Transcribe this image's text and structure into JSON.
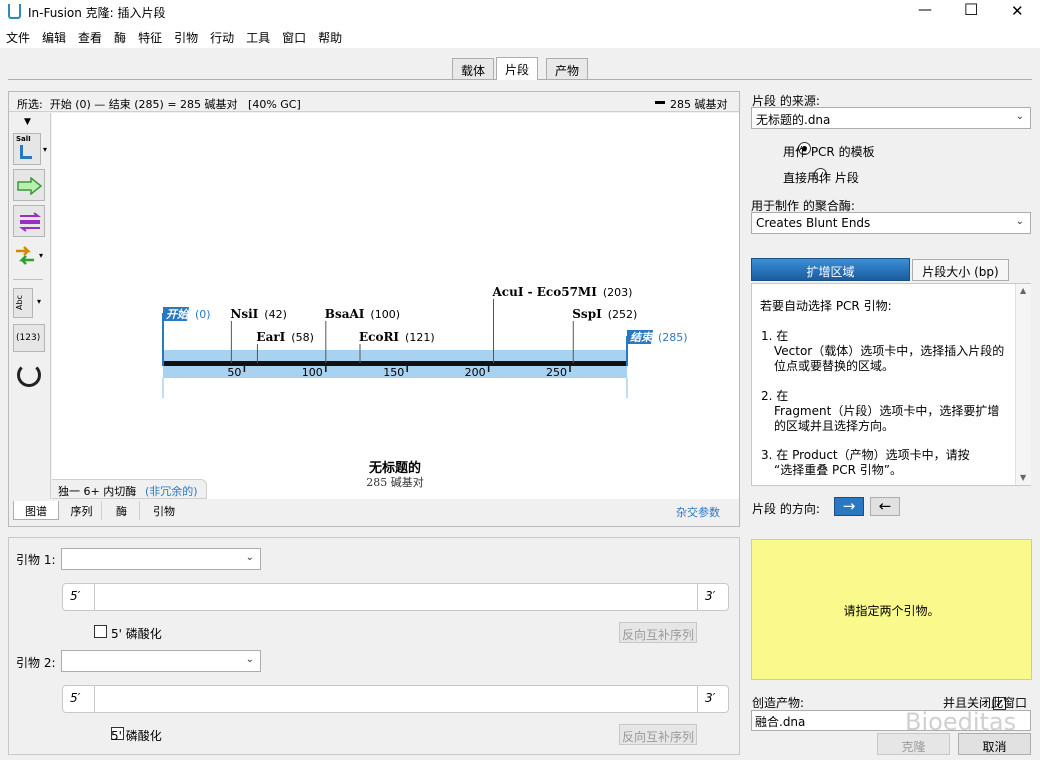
{
  "window": {
    "title": "In-Fusion 克隆: 插入片段",
    "min": "—",
    "max": "☐",
    "close": "✕"
  },
  "menu": [
    "文件",
    "编辑",
    "查看",
    "酶",
    "特征",
    "引物",
    "行动",
    "工具",
    "窗口",
    "帮助"
  ],
  "tabs": [
    {
      "label": "载体",
      "active": false
    },
    {
      "label": "片段",
      "active": true
    },
    {
      "label": "产物",
      "active": false
    }
  ],
  "infobar": {
    "text": "所选:  开始 (0) — 结束 (285) = 285 碱基对   [40% GC]",
    "length": "285 碱基对"
  },
  "tools": {
    "sali": "SalI",
    "abc": "Abc",
    "num": "(123)"
  },
  "map": {
    "start_flag": "开始",
    "start_pos": "(0)",
    "end_flag": "结束",
    "end_pos": "(285)",
    "total_bp": 285,
    "ticks": [
      "50",
      "100",
      "150",
      "200",
      "250"
    ],
    "enzymes": [
      {
        "name": "NsiI",
        "pos": "(42)"
      },
      {
        "name": "EarI",
        "pos": "(58)"
      },
      {
        "name": "BsaAI",
        "pos": "(100)"
      },
      {
        "name": "EcoRI",
        "pos": "(121)"
      },
      {
        "name": "AcuI - Eco57MI",
        "pos": "(203)"
      },
      {
        "name": "SspI",
        "pos": "(252)"
      }
    ],
    "seq_name": "无标题的",
    "seq_len": "285 碱基对",
    "unique_label": "独一 6+ 内切酶",
    "unique_link": "(非冗余的)"
  },
  "bottom_tabs": [
    "图谱",
    "序列",
    "酶",
    "引物"
  ],
  "misc_link": "杂交参数",
  "primers": {
    "p1_label": "引物 1:",
    "p2_label": "引物 2:",
    "five": "5′",
    "three": "3′",
    "phos_label": "5' 磷酸化",
    "revcomp": "反向互补序列"
  },
  "right": {
    "source_label": "片段 的来源:",
    "source_value": "无标题的.dna",
    "radio1": "用作 PCR 的模板",
    "radio2": "直接用作 片段",
    "poly_label": "用于制作 的聚合酶:",
    "poly_value": "Creates Blunt Ends",
    "btn_amp": "扩增区域",
    "btn_size": "片段大小 (bp)",
    "instr": [
      "若要自动选择 PCR 引物:",
      "1. 在",
      "Vector（载体）选项卡中，选择插入片段的",
      "位点或要替换的区域。",
      "2. 在",
      "Fragment（片段）选项卡中，选择要扩增",
      "的区域并且选择方向。",
      "3. 在 Product（产物）选项卡中，请按",
      "“选择重叠 PCR 引物”。"
    ],
    "dir_label": "片段 的方向:",
    "dir_fwd": "→",
    "dir_rev": "←",
    "message": "请指定两个引物。",
    "create_label": "创造产物:",
    "close_label": "并且关闭此窗口",
    "product_name": "融合.dna",
    "clone_btn": "克隆",
    "cancel_btn": "取消",
    "watermark": "Bioeditas"
  },
  "colors": {
    "accent": "#2b78c2",
    "backbone": "#a9d1f0",
    "message_bg": "#fafa8c"
  }
}
